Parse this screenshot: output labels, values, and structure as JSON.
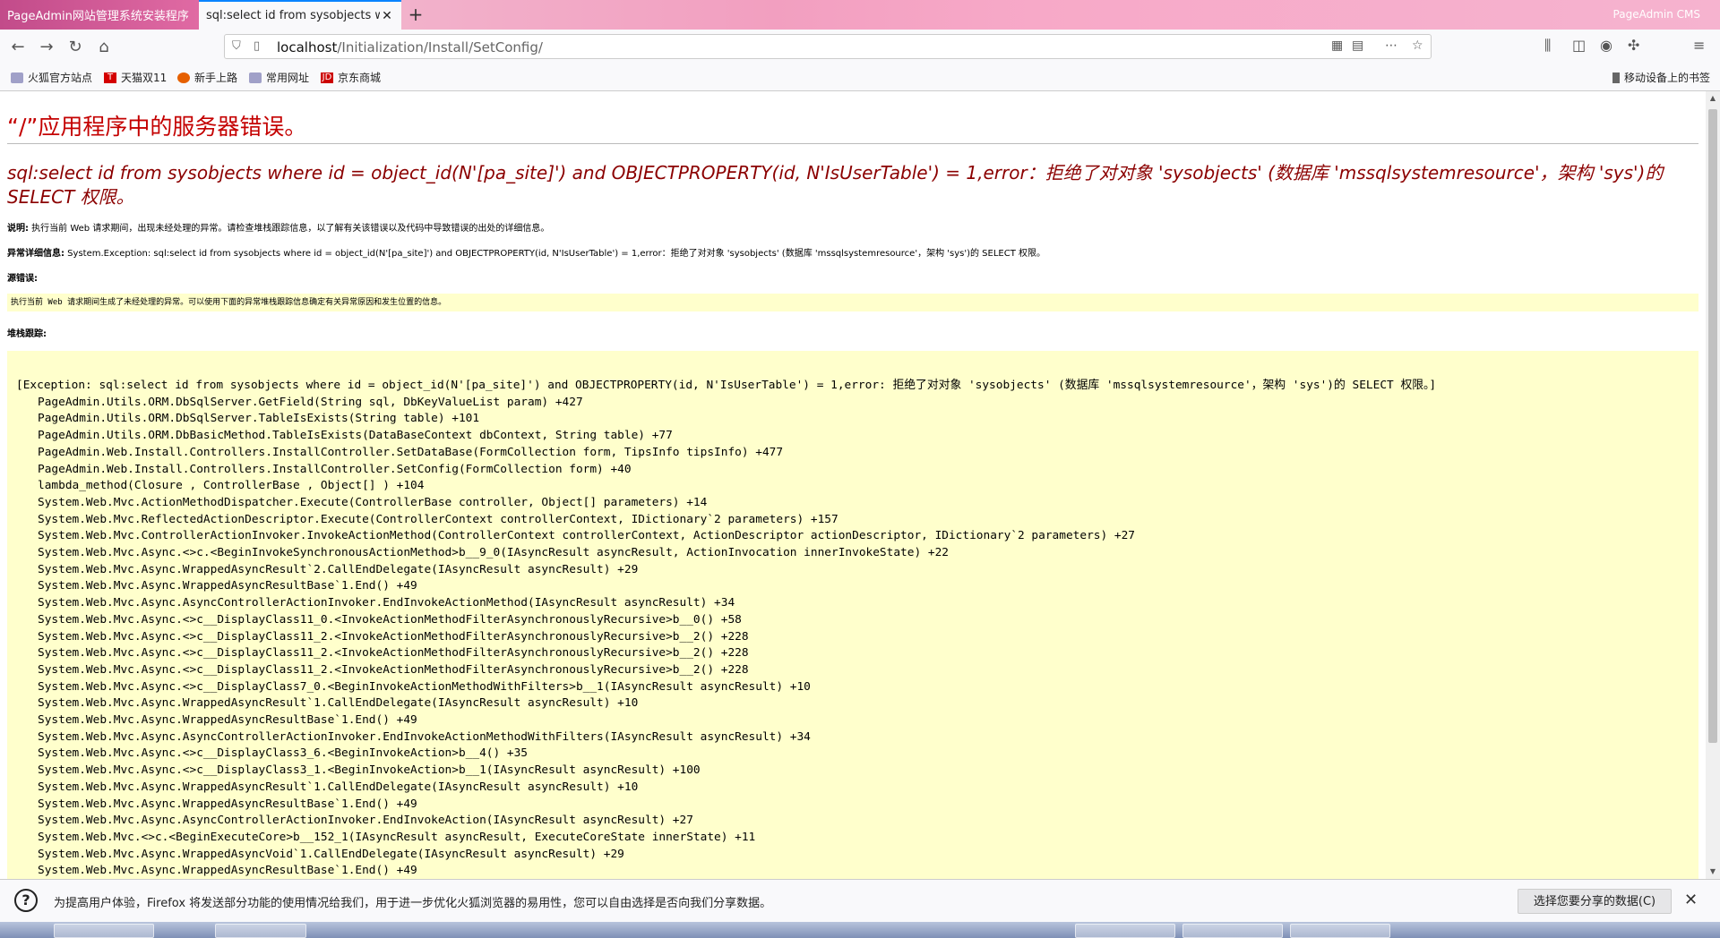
{
  "browser": {
    "tabs": [
      {
        "label": "PageAdmin网站管理系统安装程序",
        "active": false
      },
      {
        "label": "sql:select id from sysobjects whe",
        "active": true
      }
    ],
    "window_title": "PageAdmin CMS",
    "url_host": "localhost",
    "url_path": "/Initialization/Install/SetConfig/",
    "bookmarks": [
      "火狐官方站点",
      "天猫双11",
      "新手上路",
      "常用网址",
      "京东商城"
    ],
    "mobile_bookmarks": "移动设备上的书签",
    "colors": {
      "accent": "#0a84ff",
      "error_red": "#c40000",
      "error_darkred": "#8b0000",
      "code_bg": "#ffffcc"
    }
  },
  "page": {
    "title": "“/”应用程序中的服务器错误。",
    "error_message": "sql:select id from sysobjects where id = object_id(N'[pa_site]') and OBJECTPROPERTY(id, N'IsUserTable') = 1,error：拒绝了对对象 'sysobjects' (数据库 'mssqlsystemresource'，架构 'sys')的 SELECT 权限。",
    "description_label": "说明:",
    "description_text": " 执行当前 Web 请求期间，出现未经处理的异常。请检查堆栈跟踪信息，以了解有关该错误以及代码中导致错误的出处的详细信息。",
    "exception_label": "异常详细信息:",
    "exception_text": " System.Exception: sql:select id from sysobjects where id = object_id(N'[pa_site]') and OBJECTPROPERTY(id, N'IsUserTable') = 1,error：拒绝了对对象 'sysobjects' (数据库 'mssqlsystemresource'，架构 'sys')的 SELECT 权限。",
    "source_error_label": "源错误:",
    "source_error_text": "执行当前 Web 请求期间生成了未经处理的异常。可以使用下面的异常堆栈跟踪信息确定有关异常原因和发生位置的信息。",
    "stack_trace_label": "堆栈跟踪:",
    "stack_header": "[Exception: sql:select id from sysobjects where id = object_id(N'[pa_site]') and OBJECTPROPERTY(id, N'IsUserTable') = 1,error: 拒绝了对对象 'sysobjects' (数据库 'mssqlsystemresource'，架构 'sys')的 SELECT 权限。]",
    "stack_lines": [
      "PageAdmin.Utils.ORM.DbSqlServer.GetField(String sql, DbKeyValueList param) +427",
      "PageAdmin.Utils.ORM.DbSqlServer.TableIsExists(String table) +101",
      "PageAdmin.Utils.ORM.DbBasicMethod.TableIsExists(DataBaseContext dbContext, String table) +77",
      "PageAdmin.Web.Install.Controllers.InstallController.SetDataBase(FormCollection form, TipsInfo tipsInfo) +477",
      "PageAdmin.Web.Install.Controllers.InstallController.SetConfig(FormCollection form) +40",
      "lambda_method(Closure , ControllerBase , Object[] ) +104",
      "System.Web.Mvc.ActionMethodDispatcher.Execute(ControllerBase controller, Object[] parameters) +14",
      "System.Web.Mvc.ReflectedActionDescriptor.Execute(ControllerContext controllerContext, IDictionary`2 parameters) +157",
      "System.Web.Mvc.ControllerActionInvoker.InvokeActionMethod(ControllerContext controllerContext, ActionDescriptor actionDescriptor, IDictionary`2 parameters) +27",
      "System.Web.Mvc.Async.<>c.<BeginInvokeSynchronousActionMethod>b__9_0(IAsyncResult asyncResult, ActionInvocation innerInvokeState) +22",
      "System.Web.Mvc.Async.WrappedAsyncResult`2.CallEndDelegate(IAsyncResult asyncResult) +29",
      "System.Web.Mvc.Async.WrappedAsyncResultBase`1.End() +49",
      "System.Web.Mvc.Async.AsyncControllerActionInvoker.EndInvokeActionMethod(IAsyncResult asyncResult) +34",
      "System.Web.Mvc.Async.<>c__DisplayClass11_0.<InvokeActionMethodFilterAsynchronouslyRecursive>b__0() +58",
      "System.Web.Mvc.Async.<>c__DisplayClass11_2.<InvokeActionMethodFilterAsynchronouslyRecursive>b__2() +228",
      "System.Web.Mvc.Async.<>c__DisplayClass11_2.<InvokeActionMethodFilterAsynchronouslyRecursive>b__2() +228",
      "System.Web.Mvc.Async.<>c__DisplayClass11_2.<InvokeActionMethodFilterAsynchronouslyRecursive>b__2() +228",
      "System.Web.Mvc.Async.<>c__DisplayClass7_0.<BeginInvokeActionMethodWithFilters>b__1(IAsyncResult asyncResult) +10",
      "System.Web.Mvc.Async.WrappedAsyncResult`1.CallEndDelegate(IAsyncResult asyncResult) +10",
      "System.Web.Mvc.Async.WrappedAsyncResultBase`1.End() +49",
      "System.Web.Mvc.Async.AsyncControllerActionInvoker.EndInvokeActionMethodWithFilters(IAsyncResult asyncResult) +34",
      "System.Web.Mvc.Async.<>c__DisplayClass3_6.<BeginInvokeAction>b__4() +35",
      "System.Web.Mvc.Async.<>c__DisplayClass3_1.<BeginInvokeAction>b__1(IAsyncResult asyncResult) +100",
      "System.Web.Mvc.Async.WrappedAsyncResult`1.CallEndDelegate(IAsyncResult asyncResult) +10",
      "System.Web.Mvc.Async.WrappedAsyncResultBase`1.End() +49",
      "System.Web.Mvc.Async.AsyncControllerActionInvoker.EndInvokeAction(IAsyncResult asyncResult) +27",
      "System.Web.Mvc.<>c.<BeginExecuteCore>b__152_1(IAsyncResult asyncResult, ExecuteCoreState innerState) +11",
      "System.Web.Mvc.Async.WrappedAsyncVoid`1.CallEndDelegate(IAsyncResult asyncResult) +29",
      "System.Web.Mvc.Async.WrappedAsyncResultBase`1.End() +49"
    ]
  },
  "notification": {
    "text": "为提高用户体验，Firefox 将发送部分功能的使用情况给我们，用于进一步优化火狐浏览器的易用性，您可以自由选择是否向我们分享数据。",
    "button": "选择您要分享的数据(C)"
  },
  "icons": [
    "back-icon",
    "forward-icon",
    "reload-icon",
    "home-icon",
    "shield-icon",
    "page-icon",
    "qr-icon",
    "reader-icon",
    "more-icon",
    "star-icon",
    "library-icon",
    "sidebar-icon",
    "account-icon",
    "extension-icon",
    "menu-icon",
    "question-icon",
    "close-icon"
  ]
}
